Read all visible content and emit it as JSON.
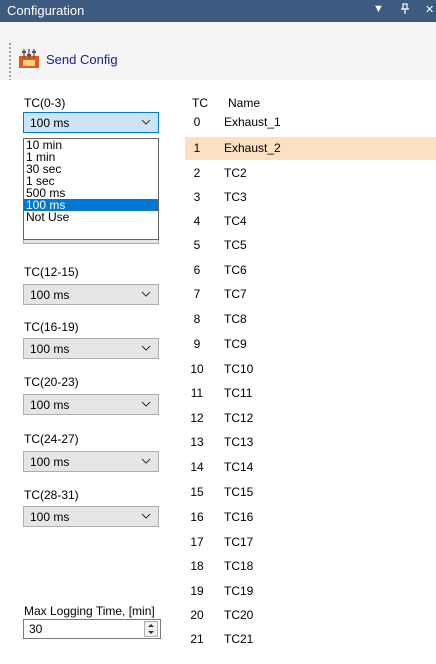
{
  "titlebar": {
    "title": "Configuration"
  },
  "toolbar": {
    "send_label": "Send Config"
  },
  "groups": [
    {
      "label": "TC(0-3)",
      "value": "100 ms"
    },
    {
      "label": "TC(12-15)",
      "value": "100 ms"
    },
    {
      "label": "TC(16-19)",
      "value": "100 ms"
    },
    {
      "label": "TC(20-23)",
      "value": "100 ms"
    },
    {
      "label": "TC(24-27)",
      "value": "100 ms"
    },
    {
      "label": "TC(28-31)",
      "value": "100 ms"
    }
  ],
  "dropdown": {
    "options": [
      "10 min",
      "1 min",
      "30 sec",
      "1 sec",
      "500 ms",
      "100 ms",
      "Not Use"
    ],
    "selected": "100 ms"
  },
  "max_logging": {
    "label": "Max Logging Time, [min]",
    "value": "30"
  },
  "table": {
    "headers": {
      "tc": "TC",
      "name": "Name"
    },
    "rows": [
      {
        "tc": "0",
        "name": "Exhaust_1"
      },
      {
        "tc": "1",
        "name": "Exhaust_2"
      },
      {
        "tc": "2",
        "name": "TC2"
      },
      {
        "tc": "3",
        "name": "TC3"
      },
      {
        "tc": "4",
        "name": "TC4"
      },
      {
        "tc": "5",
        "name": "TC5"
      },
      {
        "tc": "6",
        "name": "TC6"
      },
      {
        "tc": "7",
        "name": "TC7"
      },
      {
        "tc": "8",
        "name": "TC8"
      },
      {
        "tc": "9",
        "name": "TC9"
      },
      {
        "tc": "10",
        "name": "TC10"
      },
      {
        "tc": "11",
        "name": "TC11"
      },
      {
        "tc": "12",
        "name": "TC12"
      },
      {
        "tc": "13",
        "name": "TC13"
      },
      {
        "tc": "14",
        "name": "TC14"
      },
      {
        "tc": "15",
        "name": "TC15"
      },
      {
        "tc": "16",
        "name": "TC16"
      },
      {
        "tc": "17",
        "name": "TC17"
      },
      {
        "tc": "18",
        "name": "TC18"
      },
      {
        "tc": "19",
        "name": "TC19"
      },
      {
        "tc": "20",
        "name": "TC20"
      },
      {
        "tc": "21",
        "name": "TC21"
      }
    ],
    "highlighted_row": "1"
  },
  "colors": {
    "titlebar": "#3d5a80",
    "highlight": "#fbe0c2",
    "selection": "#0078d7"
  },
  "icons": [
    "dropdown-arrow-icon",
    "pin-icon",
    "close-icon",
    "send-config-icon",
    "chevron-down-icon",
    "spin-up-icon",
    "spin-down-icon"
  ]
}
